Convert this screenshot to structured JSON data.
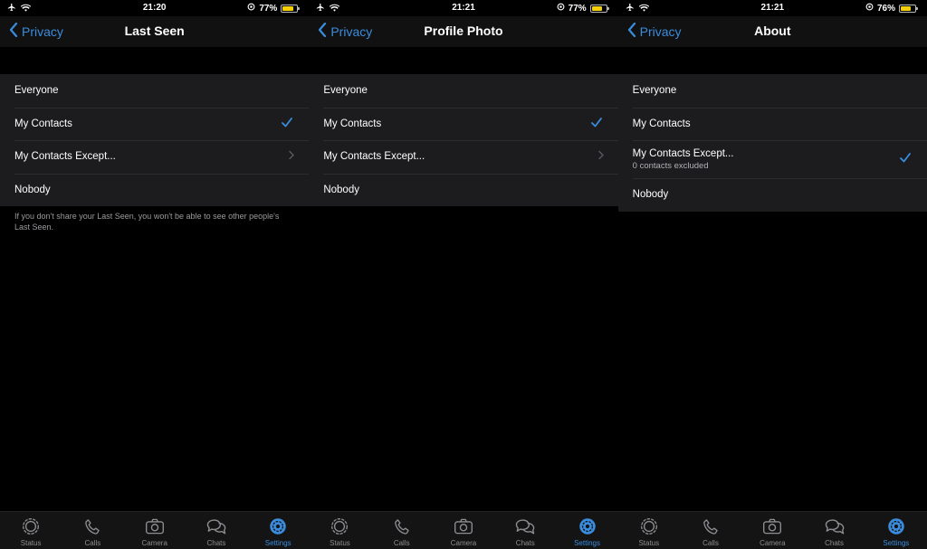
{
  "accent_color": "#3a8dde",
  "back_label": "Privacy",
  "tabs": [
    {
      "label": "Status",
      "icon": "status-icon"
    },
    {
      "label": "Calls",
      "icon": "phone-icon"
    },
    {
      "label": "Camera",
      "icon": "camera-icon"
    },
    {
      "label": "Chats",
      "icon": "chats-icon"
    },
    {
      "label": "Settings",
      "icon": "settings-icon",
      "active": true
    }
  ],
  "screens": [
    {
      "time": "21:20",
      "battery": "77%",
      "battery_level": 0.77,
      "title": "Last Seen",
      "options": [
        {
          "label": "Everyone"
        },
        {
          "label": "My Contacts",
          "selected": true
        },
        {
          "label": "My Contacts Except...",
          "chevron": true
        },
        {
          "label": "Nobody"
        }
      ],
      "footnote": "If you don't share your Last Seen, you won't be able to see other people's Last Seen."
    },
    {
      "time": "21:21",
      "battery": "77%",
      "battery_level": 0.77,
      "title": "Profile Photo",
      "options": [
        {
          "label": "Everyone"
        },
        {
          "label": "My Contacts",
          "selected": true
        },
        {
          "label": "My Contacts Except...",
          "chevron": true
        },
        {
          "label": "Nobody"
        }
      ]
    },
    {
      "time": "21:21",
      "battery": "76%",
      "battery_level": 0.76,
      "title": "About",
      "options": [
        {
          "label": "Everyone"
        },
        {
          "label": "My Contacts"
        },
        {
          "label": "My Contacts Except...",
          "sub": "0 contacts excluded",
          "selected": true
        },
        {
          "label": "Nobody"
        }
      ]
    }
  ]
}
